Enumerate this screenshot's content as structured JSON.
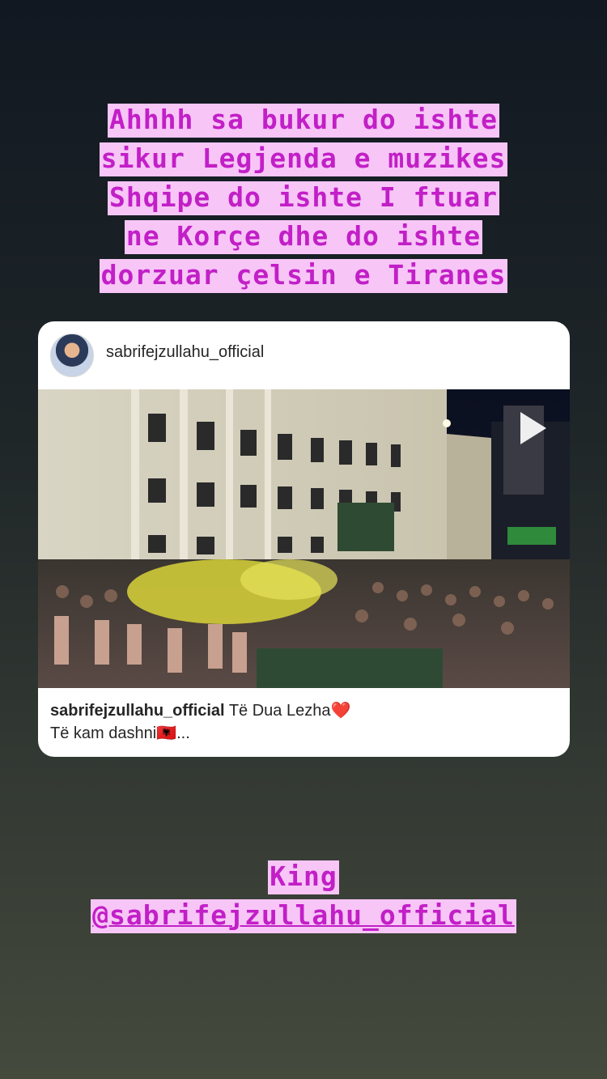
{
  "story_text": {
    "lines": [
      "Ahhhh sa bukur do ishte",
      "sikur Legjenda e muzikes",
      "Shqipe do ishte I ftuar",
      "ne Korçe dhe do ishte",
      "dorzuar çelsin e Tiranes"
    ]
  },
  "post": {
    "username": "sabrifejzullahu_official",
    "caption_user": "sabrifejzullahu_official",
    "caption_line1": "Të Dua Lezha❤️",
    "caption_line2": "Të kam dashni🇦🇱...",
    "media_icon": "play-icon"
  },
  "mention": {
    "line1": "King",
    "line2": "@sabrifejzullahu_official"
  },
  "colors": {
    "highlight_bg": "#f7c6f7",
    "highlight_text": "#c21fc7"
  }
}
